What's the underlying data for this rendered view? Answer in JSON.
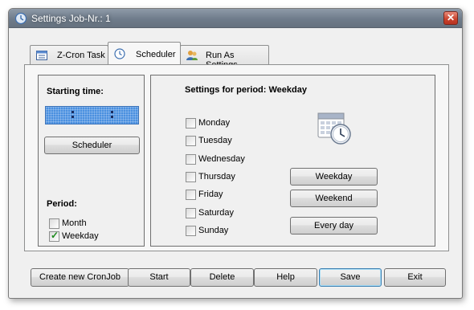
{
  "window": {
    "title": "Settings Job-Nr.: 1",
    "close_glyph": "✕"
  },
  "tabs": [
    {
      "label": "Z-Cron Task",
      "icon": "task-list-icon",
      "active": false
    },
    {
      "label": "Scheduler",
      "icon": "clock-icon",
      "active": true
    },
    {
      "label": "Run As Settings",
      "icon": "users-icon",
      "active": false
    }
  ],
  "left_group": {
    "starting_time_label": "Starting time:",
    "time_value": "",
    "scheduler_button": "Scheduler",
    "period_label": "Period:",
    "period_options": [
      {
        "label": "Month",
        "checked": false
      },
      {
        "label": "Weekday",
        "checked": true
      }
    ]
  },
  "right_group": {
    "heading": "Settings for period: Weekday",
    "days": [
      {
        "label": "Monday",
        "checked": false
      },
      {
        "label": "Tuesday",
        "checked": false
      },
      {
        "label": "Wednesday",
        "checked": false
      },
      {
        "label": "Thursday",
        "checked": false
      },
      {
        "label": "Friday",
        "checked": false
      },
      {
        "label": "Saturday",
        "checked": false
      },
      {
        "label": "Sunday",
        "checked": false
      }
    ],
    "buttons": {
      "weekday": "Weekday",
      "weekend": "Weekend",
      "every_day": "Every day"
    },
    "calendar_icon": "calendar-clock-icon"
  },
  "footer": {
    "create": "Create new CronJob",
    "start": "Start",
    "delete": "Delete",
    "help": "Help",
    "save": "Save",
    "exit": "Exit"
  },
  "colors": {
    "titlebar": "#6f7c8b",
    "time_display": "#4a90e0",
    "close_button": "#c8412c",
    "check_tick": "#1b8a1b"
  }
}
